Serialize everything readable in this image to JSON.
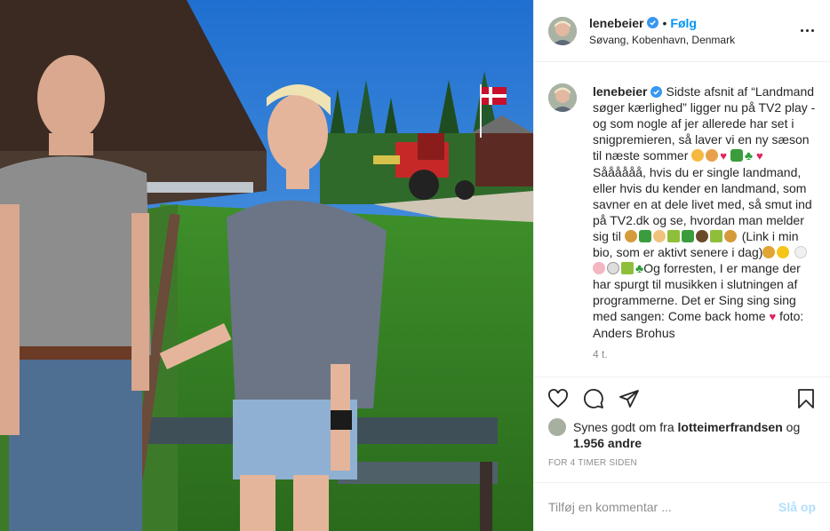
{
  "post": {
    "image_alt": "Photo of a man and a woman standing by old farm machinery with a red tractor and Danish flag in the background",
    "author": {
      "username": "lenebeier",
      "follow_label": "Følg",
      "dot": "•",
      "location": "Søvang, Kobenhavn, Denmark"
    },
    "caption": {
      "username": "lenebeier",
      "text_1": "Sidste afsnit af “Landmand søger kærlighed” ligger nu på TV2 play - og som nogle af jer allerede har set i snigpremieren, så laver vi en ny sæson til næste sommer",
      "text_2": "Såååååå, hvis du er single landmand, eller hvis du kender en landmand, som savner en at dele livet med, så smut ind på TV2.dk og se, hvordan man melder sig til",
      "text_3": "(Link i min bio, som er aktivt senere i dag)",
      "text_4": "Og forresten, I er mange der har spurgt til musikken i slutningen af programmerne. Det er Sing sing sing med sangen: Come back home",
      "text_5": "foto: Anders Brohus"
    },
    "time_ago": "4 t.",
    "likes": {
      "prefix": "Synes godt om fra",
      "first_liker": "lotteimerfrandsen",
      "joiner": "og",
      "others": "1.956 andre"
    },
    "timestamp": "FOR 4 TIMER SIDEN",
    "comment": {
      "placeholder": "Tilføj en kommentar ...",
      "post_label": "Slå op"
    },
    "icons": [
      "verified-icon",
      "more-options-icon",
      "like-heart-icon",
      "comment-icon",
      "share-icon",
      "save-icon"
    ],
    "colors": {
      "accent": "#0095f6",
      "post_disabled": "#b2dffc",
      "heart": "#e0245e",
      "muted": "#8e8e8e"
    }
  }
}
